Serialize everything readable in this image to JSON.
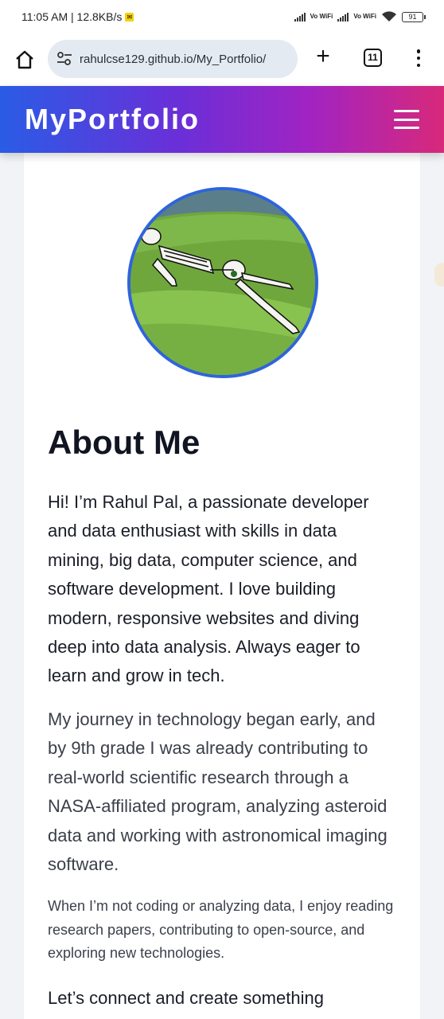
{
  "status_bar": {
    "time_speed": "11:05 AM | 12.8KB/s",
    "volte1": "Vo WiFi",
    "volte2": "Vo WiFi",
    "battery": "91"
  },
  "browser": {
    "url": "rahulcse129.github.io/My_Portfolio/",
    "tab_count": "11"
  },
  "nav": {
    "brand": "MyPortfolio"
  },
  "about": {
    "title": "About Me",
    "paragraphs": [
      "Hi! I’m Rahul Pal, a passionate developer and data enthusiast with skills in data mining, big data, computer science, and software development. I love building modern, responsive websites and diving deep into data analysis. Always eager to learn and grow in tech.",
      "My journey in technology began early, and by 9th grade I was already contributing to real-world scientific research through a NASA-affiliated program, analyzing asteroid data and working with astronomical imaging software.",
      "When I’m not coding or analyzing data, I enjoy reading research papers, contributing to open-source, and exploring new technologies.",
      "Let’s connect and create something"
    ]
  },
  "colors": {
    "nav_gradient_start": "#2a5ce6",
    "nav_gradient_end": "#d8297a",
    "avatar_border": "#2f64dc"
  },
  "icons": {
    "home": "home-icon",
    "site_settings": "tune-icon",
    "new_tab": "plus-icon",
    "tabs": "tab-switcher-icon",
    "menu": "kebab-menu-icon",
    "nav_menu": "hamburger-icon"
  }
}
